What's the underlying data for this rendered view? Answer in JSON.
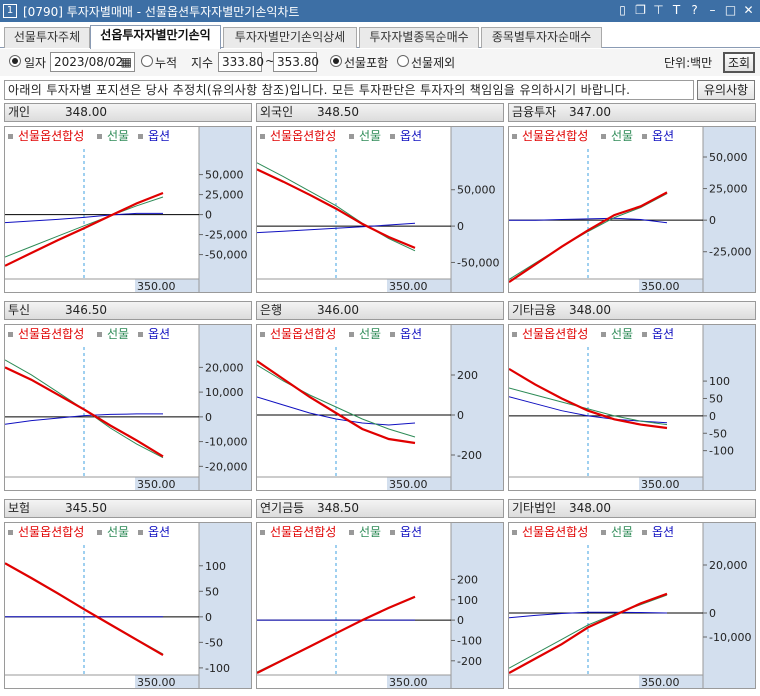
{
  "window": {
    "number": "1",
    "title": "[0790] 투자자별매매 - 선물옵션투자자별만기손익차트",
    "controls": [
      "restore-icon",
      "copy-icon",
      "pin-icon",
      "text-size-icon",
      "help-icon",
      "minimize-icon",
      "maximize-icon",
      "close-icon"
    ]
  },
  "tabs": [
    {
      "label": "선물투자주체",
      "active": false
    },
    {
      "label": "선옵투자자별만기손익",
      "active": true
    },
    {
      "label": "투자자별만기손익상세",
      "active": false
    },
    {
      "label": "투자자별종목순매수",
      "active": false
    },
    {
      "label": "종목별투자자순매수",
      "active": false
    }
  ],
  "options": {
    "daily_label": "일자",
    "date_value": "2023/08/02",
    "cumulative_label": "누적",
    "index_label": "지수",
    "index_from": "333.80",
    "range_sep": "~",
    "index_to": "353.80",
    "include_futures_label": "선물포함",
    "exclude_futures_label": "선물제외",
    "unit_label": "단위:백만",
    "query_button": "조회"
  },
  "notice": {
    "text": "아래의 투자자별 포지션은 당사 추정치(유의사항 참조)입니다. 모든 투자판단은 투자자의 책임임을 유의하시기 바랍니다.",
    "button": "유의사항"
  },
  "legend": {
    "combined": "선물옵션합성",
    "futures": "선물",
    "options": "옵션"
  },
  "colors": {
    "combined": "#e00000",
    "futures": "#2e8b57",
    "options": "#1010c0",
    "axis_bg": "#d3dfee",
    "center_line": "#3fa0e0"
  },
  "x_label": "350.00",
  "x_range": [
    333.8,
    353.8
  ],
  "center_x": 343.8,
  "panels": [
    {
      "name": "개인",
      "value": "348.00",
      "ylim": [
        -78000,
        72000
      ],
      "ticks": [
        "50,000",
        "25,000",
        "0",
        "-25,000",
        "-50,000"
      ],
      "tick_values": [
        50000,
        25000,
        0,
        -25000,
        -50000
      ],
      "combined": [
        -64000,
        -48000,
        -32000,
        -17000,
        -1500,
        14000,
        27000
      ],
      "futures": [
        -53000,
        -40000,
        -27000,
        -14000,
        -1500,
        11000,
        22000
      ],
      "options": [
        -10000,
        -8000,
        -6000,
        -3500,
        -500,
        1500,
        1500
      ]
    },
    {
      "name": "외국인",
      "value": "348.50",
      "ylim": [
        -70000,
        95000
      ],
      "ticks": [
        "50,000",
        "0",
        "-50,000"
      ],
      "tick_values": [
        50000,
        0,
        -50000
      ],
      "combined": [
        78000,
        61000,
        43000,
        24000,
        3000,
        -15000,
        -30000
      ],
      "futures": [
        87000,
        68000,
        48000,
        28000,
        4000,
        -17000,
        -34000
      ],
      "options": [
        -9000,
        -7000,
        -5000,
        -3000,
        -1000,
        1500,
        4000
      ]
    },
    {
      "name": "금융투자",
      "value": "347.00",
      "ylim": [
        -45000,
        50000
      ],
      "ticks": [
        "50,000",
        "25,000",
        "0",
        "-25,000"
      ],
      "tick_values": [
        50000,
        25000,
        0,
        -25000
      ],
      "combined": [
        -49000,
        -35000,
        -21000,
        -8000,
        4000,
        11000,
        22000
      ],
      "futures": [
        -47000,
        -34000,
        -21000,
        -9000,
        2000,
        10000,
        21000
      ],
      "options": [
        0,
        0,
        500,
        1000,
        1500,
        500,
        -2000
      ]
    },
    {
      "name": "투신",
      "value": "346.50",
      "ylim": [
        -23500,
        25000
      ],
      "ticks": [
        "20,000",
        "10,000",
        "0",
        "-10,000",
        "-20,000"
      ],
      "tick_values": [
        20000,
        10000,
        0,
        -10000,
        -20000
      ],
      "combined": [
        20000,
        15000,
        9000,
        3000,
        -3500,
        -9500,
        -16000
      ],
      "futures": [
        23000,
        17000,
        10000,
        3000,
        -4500,
        -11000,
        -16500
      ],
      "options": [
        -3000,
        -1500,
        -500,
        500,
        1000,
        1200,
        1200
      ]
    },
    {
      "name": "은행",
      "value": "346.00",
      "ylim": [
        -300,
        300
      ],
      "ticks": [
        "200",
        "0",
        "-200"
      ],
      "tick_values": [
        200,
        0,
        -200
      ],
      "combined": [
        270,
        180,
        90,
        10,
        -70,
        -120,
        -140
      ],
      "futures": [
        250,
        170,
        100,
        40,
        -20,
        -70,
        -110
      ],
      "options": [
        90,
        50,
        10,
        -20,
        -40,
        -50,
        -40
      ]
    },
    {
      "name": "기타금융",
      "value": "348.00",
      "ylim": [
        -170,
        175
      ],
      "ticks": [
        "100",
        "50",
        "0",
        "-50",
        "-100"
      ],
      "tick_values": [
        100,
        50,
        0,
        -50,
        -100
      ],
      "combined": [
        135,
        90,
        50,
        15,
        -10,
        -25,
        -35
      ],
      "futures": [
        80,
        60,
        40,
        20,
        0,
        -15,
        -25
      ],
      "options": [
        55,
        35,
        15,
        0,
        -10,
        -15,
        -20
      ]
    },
    {
      "name": "보험",
      "value": "345.50",
      "ylim": [
        -110,
        125
      ],
      "ticks": [
        "100",
        "50",
        "0",
        "-50",
        "-100"
      ],
      "tick_values": [
        100,
        50,
        0,
        -50,
        -100
      ],
      "combined": [
        105,
        76,
        46,
        15,
        -15,
        -45,
        -75
      ],
      "futures": [
        104,
        75,
        45,
        15,
        -14,
        -44,
        -73
      ],
      "options": [
        0,
        0,
        0,
        0,
        0,
        0,
        0
      ]
    },
    {
      "name": "연기금등",
      "value": "348.50",
      "ylim": [
        -260,
        330
      ],
      "ticks": [
        "200",
        "100",
        "0",
        "-100",
        "-200"
      ],
      "tick_values": [
        200,
        100,
        0,
        -100,
        -200
      ],
      "combined": [
        -260,
        -195,
        -130,
        -65,
        0,
        60,
        115
      ],
      "futures": [
        -255,
        -192,
        -128,
        -63,
        0,
        58,
        112
      ],
      "options": [
        0,
        0,
        0,
        0,
        0,
        0,
        0
      ]
    },
    {
      "name": "기타법인",
      "value": "348.00",
      "ylim": [
        -25000,
        25000
      ],
      "ticks": [
        "20,000",
        "0",
        "-10,000"
      ],
      "tick_values": [
        20000,
        0,
        -10000
      ],
      "combined": [
        -25000,
        -19000,
        -13000,
        -6000,
        -1000,
        4000,
        8000
      ],
      "futures": [
        -23000,
        -17000,
        -11000,
        -5000,
        -500,
        3500,
        7500
      ],
      "options": [
        -2000,
        -1000,
        -200,
        300,
        300,
        200,
        0
      ]
    }
  ]
}
